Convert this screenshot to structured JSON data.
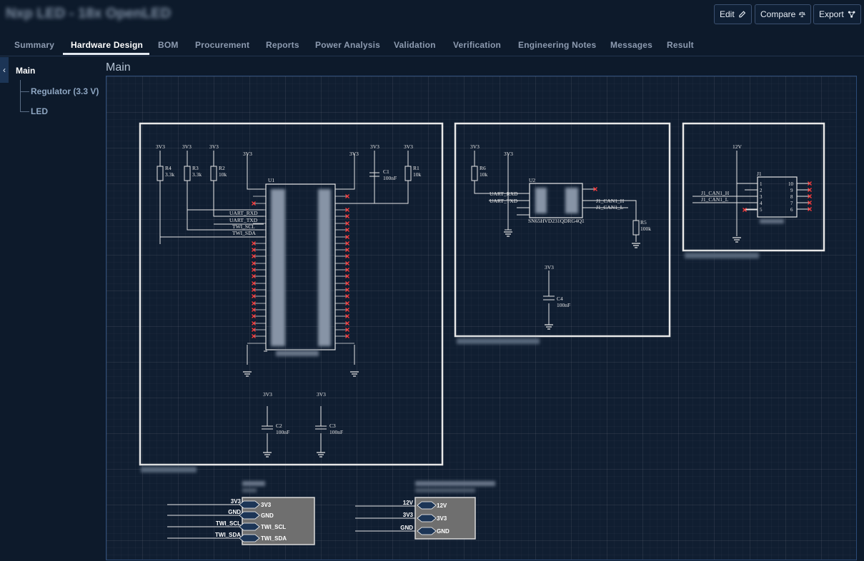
{
  "app": {
    "title": "Nxp LED - 18x OpenLED"
  },
  "toolbar": {
    "edit_label": "Edit",
    "compare_label": "Compare",
    "export_label": "Export"
  },
  "tabs": [
    {
      "label": "Summary"
    },
    {
      "label": "Hardware Design"
    },
    {
      "label": "BOM"
    },
    {
      "label": "Procurement"
    },
    {
      "label": "Reports"
    },
    {
      "label": "Power Analysis"
    },
    {
      "label": "Validation"
    },
    {
      "label": "Verification"
    },
    {
      "label": "Engineering Notes"
    },
    {
      "label": "Messages"
    },
    {
      "label": "Result"
    }
  ],
  "active_tab": "Hardware Design",
  "sidebar": {
    "root": "Main",
    "items": [
      {
        "label": "Regulator (3.3 V)"
      },
      {
        "label": "LED"
      }
    ]
  },
  "sheet": {
    "title": "Main"
  },
  "schematic": {
    "net_3v3": "3V3",
    "net_12v": "12V",
    "mcu": {
      "ref": "U1",
      "resistors": [
        {
          "ref": "R4",
          "value": "3.3k"
        },
        {
          "ref": "R3",
          "value": "3.3k"
        },
        {
          "ref": "R2",
          "value": "10k"
        },
        {
          "ref": "R1",
          "value": "10k"
        }
      ],
      "nets": [
        "UART_RXD",
        "UART_TXD",
        "TWI_SCL",
        "TWI_SDA"
      ],
      "caps": [
        {
          "ref": "C1",
          "value": "100nF"
        },
        {
          "ref": "C2",
          "value": "100nF"
        },
        {
          "ref": "C3",
          "value": "100nF"
        }
      ]
    },
    "can": {
      "ref": "U2",
      "part": "SN65HVD231QDRG4Q1",
      "resistors": [
        {
          "ref": "R6",
          "value": "10k"
        },
        {
          "ref": "R5",
          "value": "100k"
        }
      ],
      "cap": {
        "ref": "C4",
        "value": "100nF"
      },
      "nets_in": [
        "UART_RXD",
        "UART_TXD"
      ],
      "nets_out": [
        "J1_CAN1_H",
        "J1_CAN1_L"
      ]
    },
    "conn": {
      "ref": "J1",
      "nets": [
        "J1_CAN1_H",
        "J1_CAN1_L"
      ]
    },
    "blocks": [
      {
        "pins": [
          "3V3",
          "GND",
          "TWI_SCL",
          "TWI_SDA"
        ]
      },
      {
        "pins": [
          "12V",
          "3V3",
          "GND"
        ]
      }
    ]
  }
}
